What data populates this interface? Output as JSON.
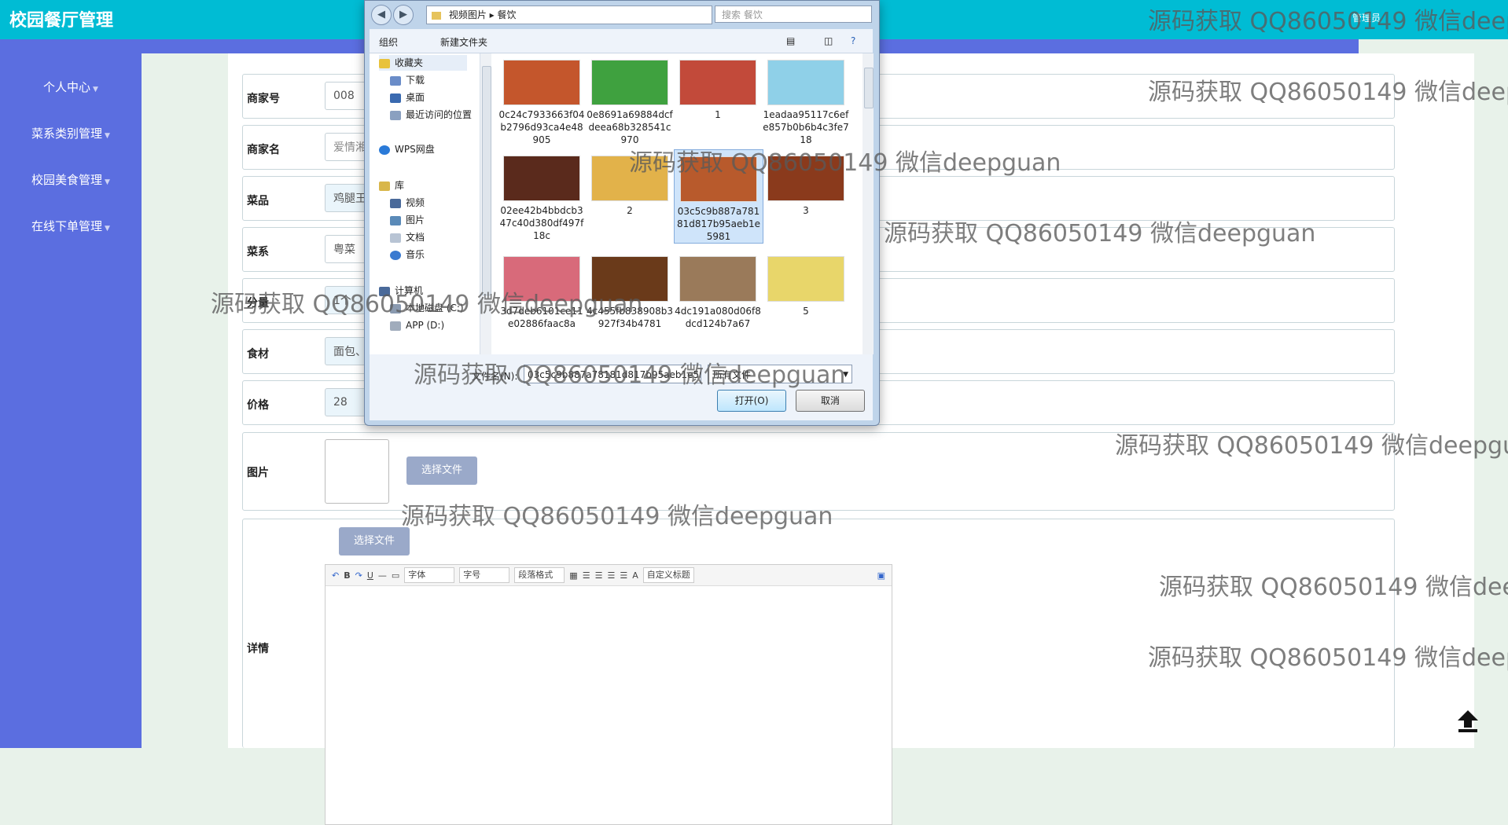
{
  "app": {
    "title": "校园餐厅管理",
    "user_info": "管理员"
  },
  "sidebar": {
    "items": [
      {
        "label": "个人中心"
      },
      {
        "label": "菜系类别管理"
      },
      {
        "label": "校园美食管理"
      },
      {
        "label": "在线下单管理"
      }
    ]
  },
  "form": {
    "merchant_no": {
      "label": "商家号",
      "value": "008"
    },
    "merchant_name": {
      "label": "商家名",
      "value": "爱情湘"
    },
    "dish": {
      "label": "菜品",
      "value": "鸡腿王"
    },
    "cuisine": {
      "label": "菜系",
      "value": "粤菜"
    },
    "portion": {
      "label": "分量",
      "value": "1个"
    },
    "ingredients": {
      "label": "食材",
      "value": "面包、"
    },
    "price": {
      "label": "价格",
      "value": "28"
    },
    "image": {
      "label": "图片",
      "button": "选择文件"
    },
    "detail": {
      "label": "详情",
      "button": "选择文件"
    }
  },
  "editor": {
    "font_label": "字体",
    "size_label": "字号",
    "para_label": "段落格式",
    "custom_title": "自定义标题",
    "buttons": [
      "B",
      "U",
      "A"
    ]
  },
  "dialog": {
    "breadcrumb": [
      "视频图片",
      "餐饮"
    ],
    "search_placeholder": "搜索 餐饮",
    "organize": "组织",
    "new_folder": "新建文件夹",
    "tree": [
      {
        "label": "收藏夹"
      },
      {
        "label": "下载"
      },
      {
        "label": "桌面"
      },
      {
        "label": "最近访问的位置"
      },
      {
        "label": "WPS网盘"
      },
      {
        "label": "库"
      },
      {
        "label": "视频"
      },
      {
        "label": "图片"
      },
      {
        "label": "文档"
      },
      {
        "label": "音乐"
      },
      {
        "label": "计算机"
      },
      {
        "label": "本地磁盘 (C:)"
      },
      {
        "label": "APP (D:)"
      }
    ],
    "files": [
      {
        "name": "0c24c7933663f04b2796d93ca4e48905",
        "color": "#c4562c"
      },
      {
        "name": "0e8691a69884dcfdeea68b328541c970",
        "color": "#3fa13f"
      },
      {
        "name": "1",
        "color": "#c24a3a"
      },
      {
        "name": "1eadaa95117c6efe857b0b6b4c3fe718",
        "color": "#8fd0e8"
      },
      {
        "name": "02ee42b4bbdcb347c40d380df497f18c",
        "color": "#5a2a1c"
      },
      {
        "name": "2",
        "color": "#e2b24a"
      },
      {
        "name": "03c5c9b887a78181d817b95aeb1e5981",
        "color": "#b85a2c"
      },
      {
        "name": "3",
        "color": "#8a3a1c"
      },
      {
        "name": "3d7deb6101ce11e02886faac8a",
        "color": "#d86a7a"
      },
      {
        "name": "4c455fb838908b3927f34b4781",
        "color": "#6a3a1a"
      },
      {
        "name": "4dc191a080d06f8dcd124b7a67",
        "color": "#9a7a5a"
      },
      {
        "name": "5",
        "color": "#e8d66a"
      }
    ],
    "filename_label": "文件名(N):",
    "filename_value": "03c5c9b887a78181d817b95aeb1e5981",
    "filetype": "所有文件",
    "open_button": "打开(O)",
    "cancel_button": "取消"
  },
  "watermark": "源码获取 QQ86050149 微信deepguan"
}
